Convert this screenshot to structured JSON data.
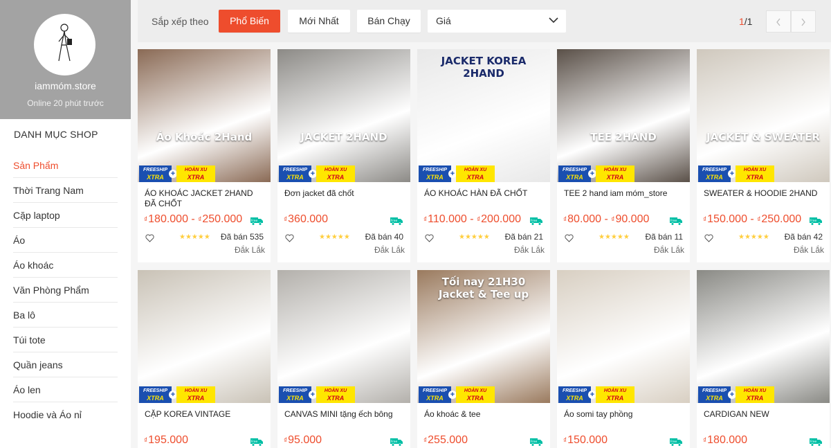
{
  "shop": {
    "name": "iammóm.store",
    "status": "Online 20 phút trước"
  },
  "categories": {
    "title": "DANH MỤC SHOP",
    "items": [
      {
        "label": "Sản Phẩm",
        "active": true
      },
      {
        "label": "Thời Trang Nam"
      },
      {
        "label": "Cặp laptop"
      },
      {
        "label": "Áo"
      },
      {
        "label": "Áo khoác"
      },
      {
        "label": "Văn Phòng Phẩm"
      },
      {
        "label": "Ba lô"
      },
      {
        "label": "Túi tote"
      },
      {
        "label": "Quần jeans"
      },
      {
        "label": "Áo len"
      },
      {
        "label": "Hoodie và Áo nỉ"
      }
    ]
  },
  "sortbar": {
    "label": "Sắp xếp theo",
    "options": [
      "Phổ Biến",
      "Mới Nhất",
      "Bán Chạy"
    ],
    "price_select": "Giá",
    "page_current": "1",
    "page_total": "/1"
  },
  "badges": {
    "freeship": "FREESHIP",
    "xtra": "XTRA",
    "hoanxu": "HOÀN XU",
    "plus": "+"
  },
  "products": [
    {
      "name": "ÁO KHOÁC JACKET 2HAND ĐÃ CHỐT",
      "price": "180.000 - ",
      "price2": "250.000",
      "stars": "★★★★★",
      "sold": "Đã bán 535",
      "location": "Đắk Lắk",
      "thumb_bg": "#8a6a55",
      "thumb_text": "Áo Khoác 2Hand"
    },
    {
      "name": "Đơn jacket đã chốt",
      "price": "360.000",
      "price2": "",
      "stars": "★★★★★",
      "sold": "Đã bán 40",
      "location": "Đắk Lắk",
      "thumb_bg": "#8c8a86",
      "thumb_text": "JACKET 2HAND"
    },
    {
      "name": "ÁO KHOÁC HÀN ĐÃ CHỐT",
      "price": "110.000 - ",
      "price2": "200.000",
      "stars": "★★★★★",
      "sold": "Đã bán 21",
      "location": "Đắk Lắk",
      "thumb_bg": "#e8e8e8",
      "thumb_text": "JACKET KOREA 2HAND"
    },
    {
      "name": "TEE 2 hand iam móm_store",
      "price": "80.000 - ",
      "price2": "90.000",
      "stars": "★★★★★",
      "sold": "Đã bán 11",
      "location": "Đắk Lắk",
      "thumb_bg": "#5a5048",
      "thumb_text": "TEE 2HAND"
    },
    {
      "name": "SWEATER & HOODIE 2HAND",
      "price": "150.000 - ",
      "price2": "250.000",
      "stars": "★★★★★",
      "sold": "Đã bán 42",
      "location": "Đắk Lắk",
      "thumb_bg": "#cfc8bd",
      "thumb_text": "JACKET & SWEATER"
    },
    {
      "name": "CẶP KOREA VINTAGE",
      "price": "195.000",
      "price2": "",
      "thumb_bg": "#c9c2b6",
      "thumb_text": ""
    },
    {
      "name": "CANVAS MINI tặng ếch bông",
      "price": "95.000",
      "price2": "",
      "thumb_bg": "#b3b0ab",
      "thumb_text": ""
    },
    {
      "name": "Áo khoác & tee",
      "price": "255.000",
      "price2": "",
      "thumb_bg": "#9a7a5e",
      "thumb_text": "Tối nay 21H30 Jacket & Tee up"
    },
    {
      "name": "Áo somi tay phồng",
      "price": "150.000",
      "price2": "",
      "thumb_bg": "#d8cfc2",
      "thumb_text": ""
    },
    {
      "name": "CARDIGAN NEW",
      "price": "180.000",
      "price2": "",
      "thumb_bg": "#8a8a85",
      "thumb_text": ""
    }
  ],
  "colors": {
    "accent": "#ee4d2d",
    "star": "#ffce3d",
    "freeship_bg": "#1a4fb0",
    "xtra_yellow": "#ffe600"
  }
}
